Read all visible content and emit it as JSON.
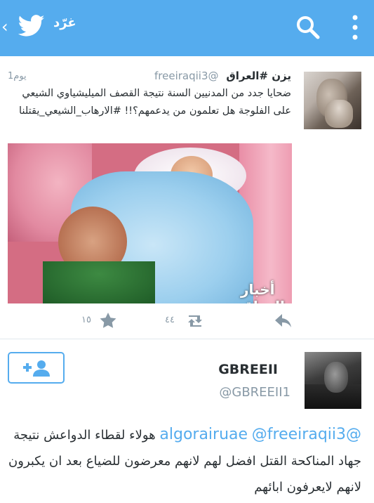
{
  "colors": {
    "brand": "#55acee",
    "text": "#292f33",
    "muted": "#8899a6"
  },
  "topbar": {
    "back_icon": "chevron-left-icon",
    "logo_icon": "twitter-bird-icon",
    "compose_label": "غرّد",
    "search_icon": "search-icon",
    "menu_icon": "overflow-menu-icon"
  },
  "tweet1": {
    "name": "يزن #العراق",
    "handle": "@freeiraqii3",
    "time": "1يوم",
    "text": "ضحايا جدد من المدنيين السنة نتيجة القصف الميليشياوي الشيعي على الفلوجة هل تعلمون من يدعمهم؟!! #الارهاب_الشيعي_يقتلنا",
    "photo_watermark": "أخبار العراق",
    "favorites_count": "١٥",
    "retweets_count": "٤٤"
  },
  "profile": {
    "name": "GBREEII",
    "handle": "@GBREEII1",
    "follow_icon": "add-user-icon"
  },
  "tweet2": {
    "mention1": "@algorairuae",
    "mention2": "@freeiraqii3",
    "text": "هولاء لقطاء الدواعش نتيجة جهاد المناكحة القتل افضل لهم لانهم معرضون للضياع بعد ان يكبرون لانهم لايعرفون ابائهم"
  }
}
